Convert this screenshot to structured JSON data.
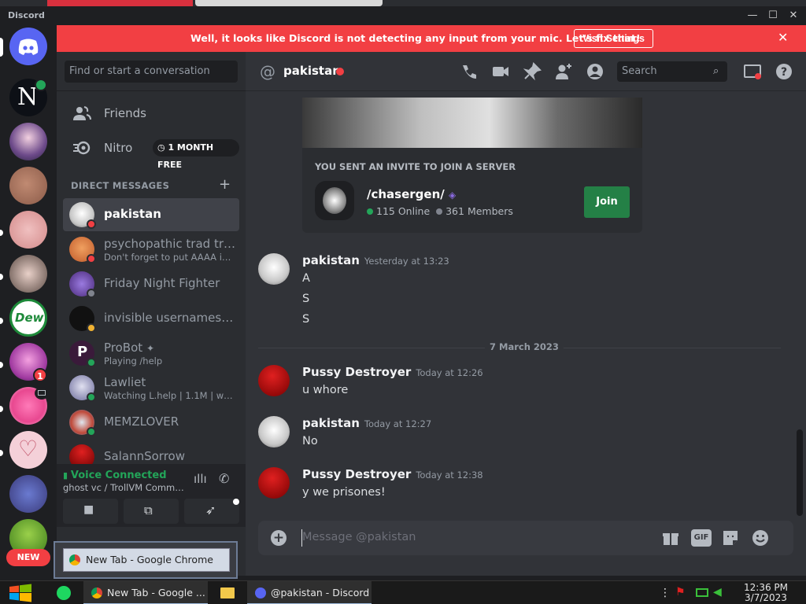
{
  "window": {
    "brand": "Discord"
  },
  "notice": {
    "message": "Well, it looks like Discord is not detecting any input from your mic. Let's fix that!",
    "button": "Visit Settings"
  },
  "sidebar": {
    "search_placeholder": "Find or start a conversation",
    "friends": "Friends",
    "nitro": "Nitro",
    "nitro_badge": "1 MONTH FREE",
    "dm_header": "DIRECT MESSAGES",
    "dms": [
      {
        "name": "pakistan",
        "sub": ""
      },
      {
        "name": "psychopathic trad tra...",
        "sub": "Don't forget to put AAAA into ..."
      },
      {
        "name": "Friday Night Fighter",
        "sub": ""
      },
      {
        "name": "invisible usernames ar...",
        "sub": ""
      },
      {
        "name": "ProBot",
        "sub": "Playing /help"
      },
      {
        "name": "Lawliet",
        "sub": "Watching L.help | 1.1M | www.l..."
      },
      {
        "name": "MEMZLOVER",
        "sub": ""
      },
      {
        "name": "SalannSorrow",
        "sub": ""
      }
    ]
  },
  "servers": {
    "new_label": "NEW",
    "badge_count": "1"
  },
  "voice": {
    "status": "Voice Connected",
    "channel": "ghost vc / TrollVM Commun..."
  },
  "tooltip": {
    "label": "New Tab - Google Chrome"
  },
  "chat": {
    "title": "pakistan",
    "search_placeholder": "Search",
    "invite": {
      "heading": "YOU SENT AN INVITE TO JOIN A SERVER",
      "server": "/chasergen/",
      "online": "115 Online",
      "members": "361 Members",
      "join": "Join"
    },
    "messages": [
      {
        "author": "pakistan",
        "time": "Yesterday at 13:23",
        "lines": [
          "A",
          "S",
          "S"
        ]
      },
      {
        "author": "Pussy Destroyer",
        "time": "Today at 12:26",
        "lines": [
          "u whore"
        ]
      },
      {
        "author": "pakistan",
        "time": "Today at 12:27",
        "lines": [
          "No"
        ]
      },
      {
        "author": "Pussy Destroyer",
        "time": "Today at 12:38",
        "lines": [
          "y we prisones!"
        ]
      }
    ],
    "date_divider": "7 March 2023",
    "composer_placeholder": "Message @pakistan",
    "gif_label": "GIF"
  },
  "taskbar": {
    "chrome": "New Tab - Google ...",
    "discord": "@pakistan - Discord",
    "time": "12:36 PM",
    "date": "3/7/2023"
  }
}
